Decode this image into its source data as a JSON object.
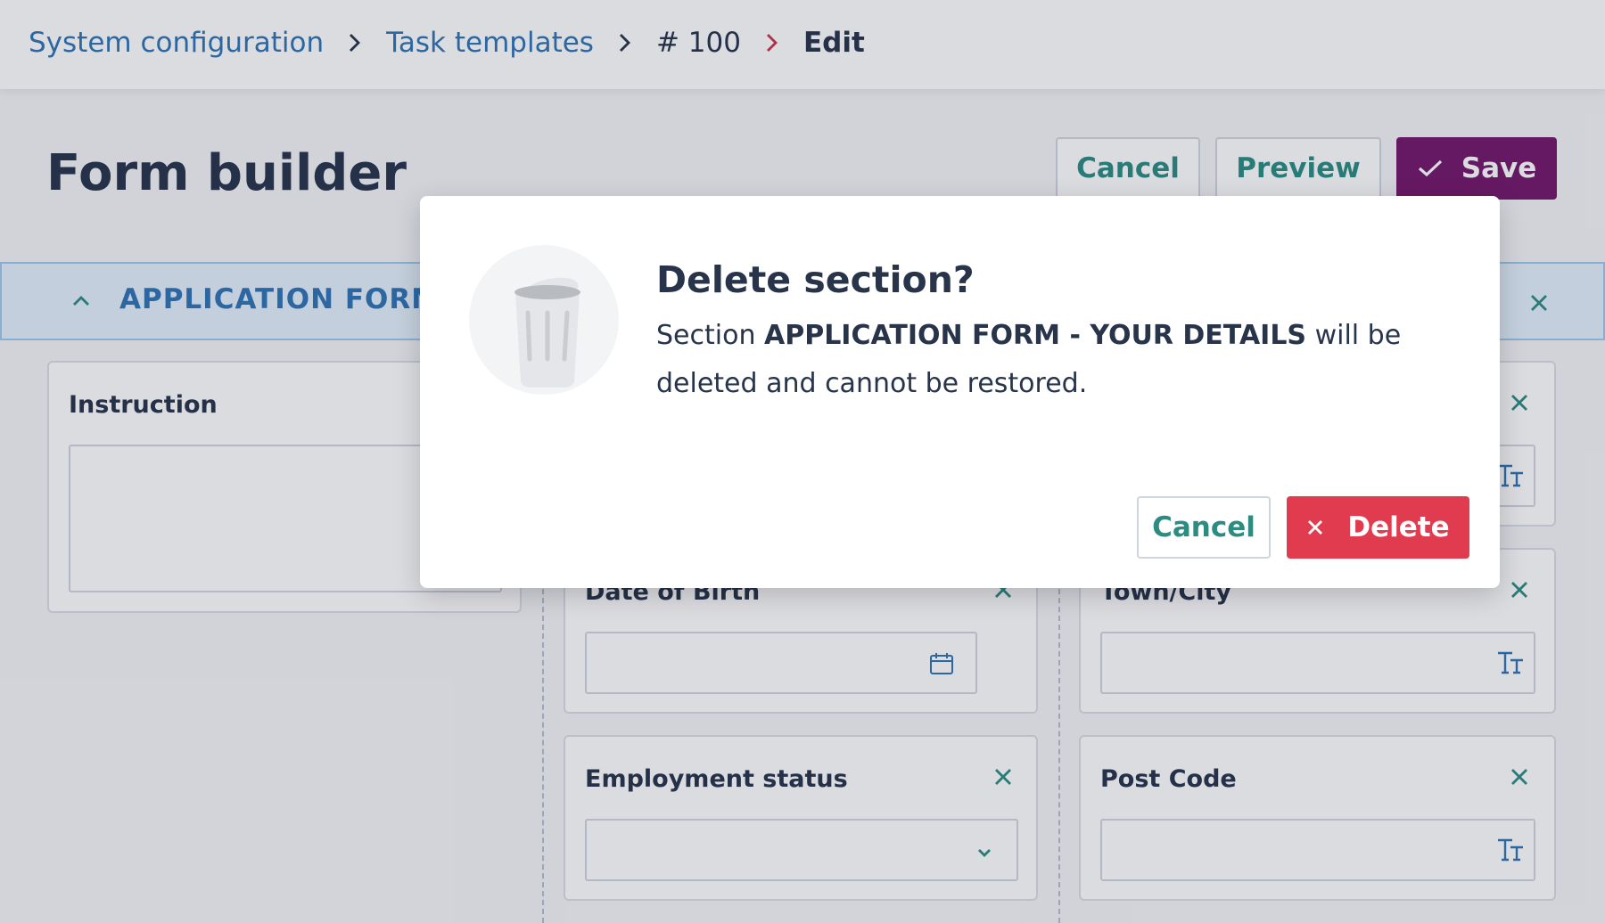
{
  "breadcrumb": {
    "items": [
      "System configuration",
      "Task templates",
      "# 100",
      "Edit"
    ]
  },
  "page": {
    "title": "Form builder"
  },
  "toolbar": {
    "cancel_label": "Cancel",
    "preview_label": "Preview",
    "save_label": "Save"
  },
  "section": {
    "title": "APPLICATION FORM - YOUR DETAILS"
  },
  "fields": {
    "instruction": "Instruction",
    "date_of_birth": "Date of Birth",
    "town_city": "Town/City",
    "employment_status": "Employment status",
    "post_code": "Post Code"
  },
  "modal": {
    "title": "Delete section?",
    "body_prefix": "Section ",
    "body_section": "APPLICATION FORM - YOUR DETAILS",
    "body_suffix": " will be deleted and cannot be restored.",
    "cancel_label": "Cancel",
    "delete_label": "Delete"
  },
  "colors": {
    "link": "#2f74b5",
    "teal_action": "#2c8c82",
    "save_purple": "#74176b",
    "delete_red": "#e03b4e",
    "separator_active": "#c8334c"
  },
  "icons": [
    "chevron-right-icon",
    "check-icon",
    "chevron-up-icon",
    "close-icon",
    "calendar-icon",
    "text-type-icon",
    "chevron-down-icon",
    "trash-icon"
  ]
}
